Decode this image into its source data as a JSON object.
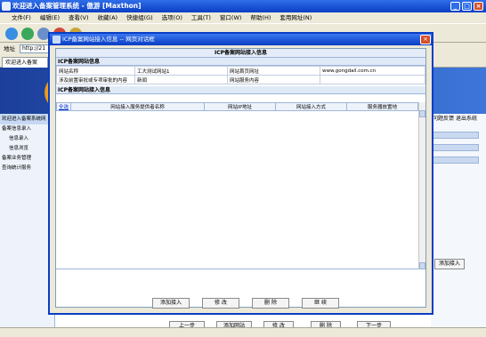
{
  "window": {
    "title": "欢迎进入备案管理系统 - 傲游 [Maxthon]"
  },
  "menu": [
    "文件(F)",
    "编辑(E)",
    "查看(V)",
    "收藏(A)",
    "快捷组(G)",
    "选项(O)",
    "工具(T)",
    "窗口(W)",
    "帮助(H)",
    "套用网址(N)"
  ],
  "address": {
    "label": "地址",
    "value": "http://21"
  },
  "tab": {
    "label": "欢迎进入备案"
  },
  "page": {
    "right_links": [
      "问题反馈",
      "退出系统"
    ],
    "right_button": "添加接入",
    "bottom_buttons": [
      "上一步",
      "添加网站",
      "修 改",
      "删 除",
      "下一步"
    ],
    "left_header": "欢迎进入备案系统网",
    "nav": [
      "备案信息录入",
      "信息录入",
      "信息浏览",
      "备案业务管理",
      "查询统计服务"
    ]
  },
  "dialog": {
    "title": "ICP备案网站接入信息 -- 网页对话框",
    "form_title": "ICP备案网站接入信息",
    "site_section": "ICP备案网站信息",
    "site_rows": [
      [
        "网站名称",
        "工大测试网站1",
        "网站首页网址",
        "www.gongdail.com.cn"
      ],
      [
        "涉及前置审批或专项审批的内容",
        "新闻",
        "网站服务内容",
        ""
      ]
    ],
    "access_section": "ICP备案网站接入信息",
    "grid_select": "全选",
    "grid_columns": [
      "网站接入服务提供者名称",
      "网站IP地址",
      "网站接入方式",
      "服务器放置地"
    ],
    "buttons": [
      "添加接入",
      "修 改",
      "删 除",
      "继 续"
    ]
  }
}
